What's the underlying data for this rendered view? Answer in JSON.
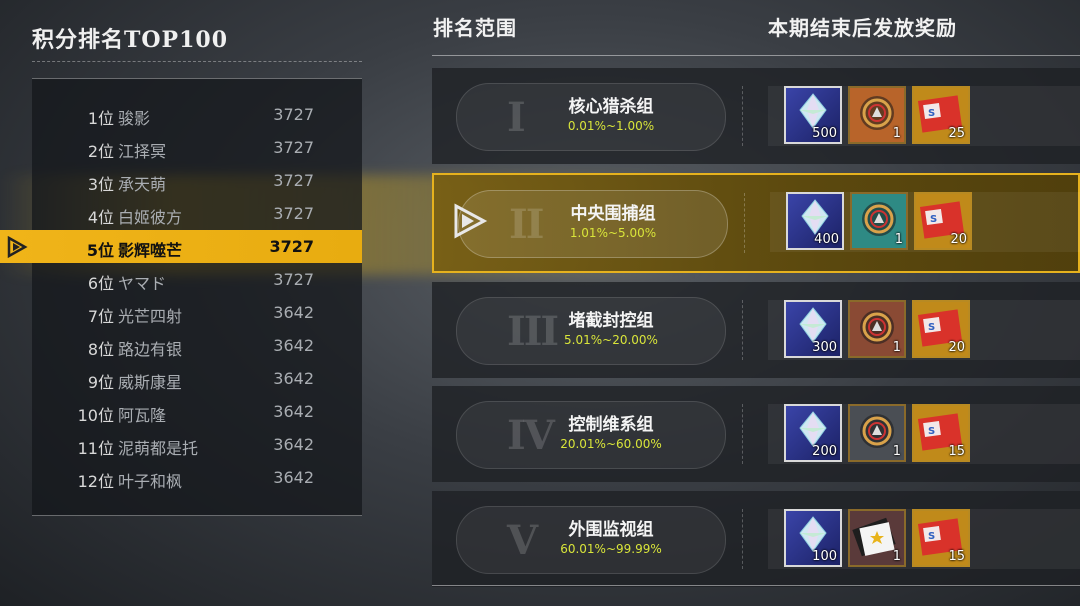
{
  "leaderboard": {
    "title": "积分排名TOP100",
    "rows": [
      {
        "pos": "1位",
        "name": "骏影",
        "score": "3727"
      },
      {
        "pos": "2位",
        "name": "江择冥",
        "score": "3727"
      },
      {
        "pos": "3位",
        "name": "承天萌",
        "score": "3727"
      },
      {
        "pos": "4位",
        "name": "白姬彼方",
        "score": "3727"
      },
      {
        "pos": "5位",
        "name": "影辉噬芒",
        "score": "3727"
      },
      {
        "pos": "6位",
        "name": "ヤマド",
        "score": "3727"
      },
      {
        "pos": "7位",
        "name": "光芒四射",
        "score": "3642"
      },
      {
        "pos": "8位",
        "name": "路边有银",
        "score": "3642"
      },
      {
        "pos": "9位",
        "name": "威斯康星",
        "score": "3642"
      },
      {
        "pos": "10位",
        "name": "阿瓦隆",
        "score": "3642"
      },
      {
        "pos": "11位",
        "name": "泥萌都是托",
        "score": "3642"
      },
      {
        "pos": "12位",
        "name": "叶子和枫",
        "score": "3642"
      }
    ],
    "highlighted_index": 4
  },
  "headers": {
    "range": "排名范围",
    "rewards": "本期结束后发放奖励"
  },
  "tiers": [
    {
      "roman": "I",
      "name": "核心猎杀组",
      "range": "0.01%~1.00%",
      "crystal": "500",
      "medal": "1",
      "ticket": "25",
      "medal_color": "#b8642a"
    },
    {
      "roman": "II",
      "name": "中央围捕组",
      "range": "1.01%~5.00%",
      "crystal": "400",
      "medal": "1",
      "ticket": "20",
      "medal_color": "#2e8a84",
      "active": true
    },
    {
      "roman": "III",
      "name": "堵截封控组",
      "range": "5.01%~20.00%",
      "crystal": "300",
      "medal": "1",
      "ticket": "20",
      "medal_color": "#8a4a34"
    },
    {
      "roman": "IV",
      "name": "控制维系组",
      "range": "20.01%~60.00%",
      "crystal": "200",
      "medal": "1",
      "ticket": "15",
      "medal_color": "#4a4e54"
    },
    {
      "roman": "V",
      "name": "外围监视组",
      "range": "60.01%~99.99%",
      "crystal": "100",
      "medal": "1",
      "ticket": "15",
      "medal_color": "#3a3c40"
    }
  ],
  "colors": {
    "highlight": "#f0b419",
    "range_text": "#d9e53a",
    "active_border": "#e6b21e"
  }
}
